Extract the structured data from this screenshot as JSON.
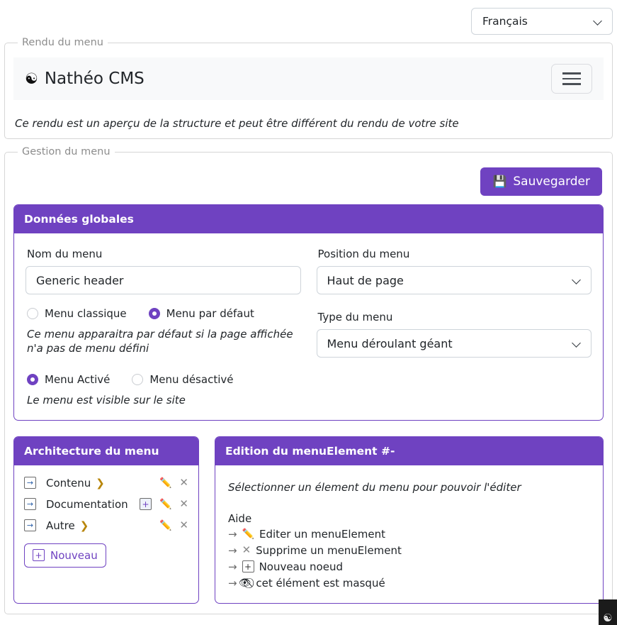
{
  "language_selector": {
    "value": "Français",
    "icon": "chevron-down-icon"
  },
  "preview_fieldset": {
    "legend": "Rendu du menu",
    "navbar": {
      "logo_icon": "yin-yang-icon",
      "logo_glyph": "☯",
      "brand": "Nathéo CMS",
      "toggle_icon": "hamburger-menu-icon"
    },
    "note": "Ce rendu est un aperçu de la structure et peut être différent du rendu de votre site"
  },
  "management_fieldset": {
    "legend": "Gestion du menu",
    "save_button": {
      "label": "Sauvegarder",
      "icon": "floppy-disk-icon",
      "glyph": "💾"
    },
    "global_data_card": {
      "title": "Données globales",
      "fields": {
        "menu_name_label": "Nom du menu",
        "menu_name_value": "Generic header",
        "menu_name_placeholder": "Nom du menu",
        "position_label": "Position du menu",
        "position_value": "Haut de page",
        "type_label": "Type du menu",
        "type_value": "Menu déroulant géant"
      },
      "radios_kind": [
        {
          "label": "Menu classique",
          "selected": false
        },
        {
          "label": "Menu par défaut",
          "selected": true
        }
      ],
      "kind_hint": "Ce menu apparaitra par défaut si la page affichée n'a pas de menu défini",
      "radios_state": [
        {
          "label": "Menu Activé",
          "selected": true
        },
        {
          "label": "Menu désactivé",
          "selected": false
        }
      ],
      "state_hint": "Le menu est visible sur le site"
    },
    "architecture_card": {
      "title": "Architecture du menu",
      "items": [
        {
          "label": "Contenu",
          "has_caret": true,
          "has_plus": false
        },
        {
          "label": "Documentation",
          "has_caret": false,
          "has_plus": true
        },
        {
          "label": "Autre",
          "has_caret": true,
          "has_plus": false
        }
      ],
      "new_button": {
        "label": "Nouveau",
        "icon": "boxed-plus-icon",
        "glyph": "+"
      },
      "row_icons": {
        "goto": "boxed-arrow-right-icon",
        "caret": "chevron-right-icon",
        "edit": "pencil-icon",
        "delete": "close-x-icon"
      }
    },
    "edition_card": {
      "title": "Edition du menuElement #-",
      "note": "Sélectionner un élement du menu pour pouvoir l'éditer",
      "help_title": "Aide",
      "help_rows": [
        {
          "arrow": "→",
          "icon": "pencil-icon",
          "glyph": "✏",
          "text": "Editer un menuElement"
        },
        {
          "arrow": "→",
          "icon": "close-x-icon",
          "glyph": "✕",
          "text": "Supprime un menuElement"
        },
        {
          "arrow": "→",
          "icon": "boxed-plus-icon",
          "glyph": "+",
          "text": "Nouveau noeud"
        },
        {
          "arrow": "→",
          "icon": "eye-slash-icon",
          "glyph": "👁",
          "text": "cet élément est masqué"
        }
      ]
    }
  },
  "corner_badge": {
    "glyph": "☯",
    "icon": "site-logo-icon"
  },
  "colors": {
    "accent_purple": "#6f42c1",
    "navbar_bg": "#f8f9fa",
    "border_gray": "#ced4da",
    "legend_gray": "#8d8d8d"
  }
}
